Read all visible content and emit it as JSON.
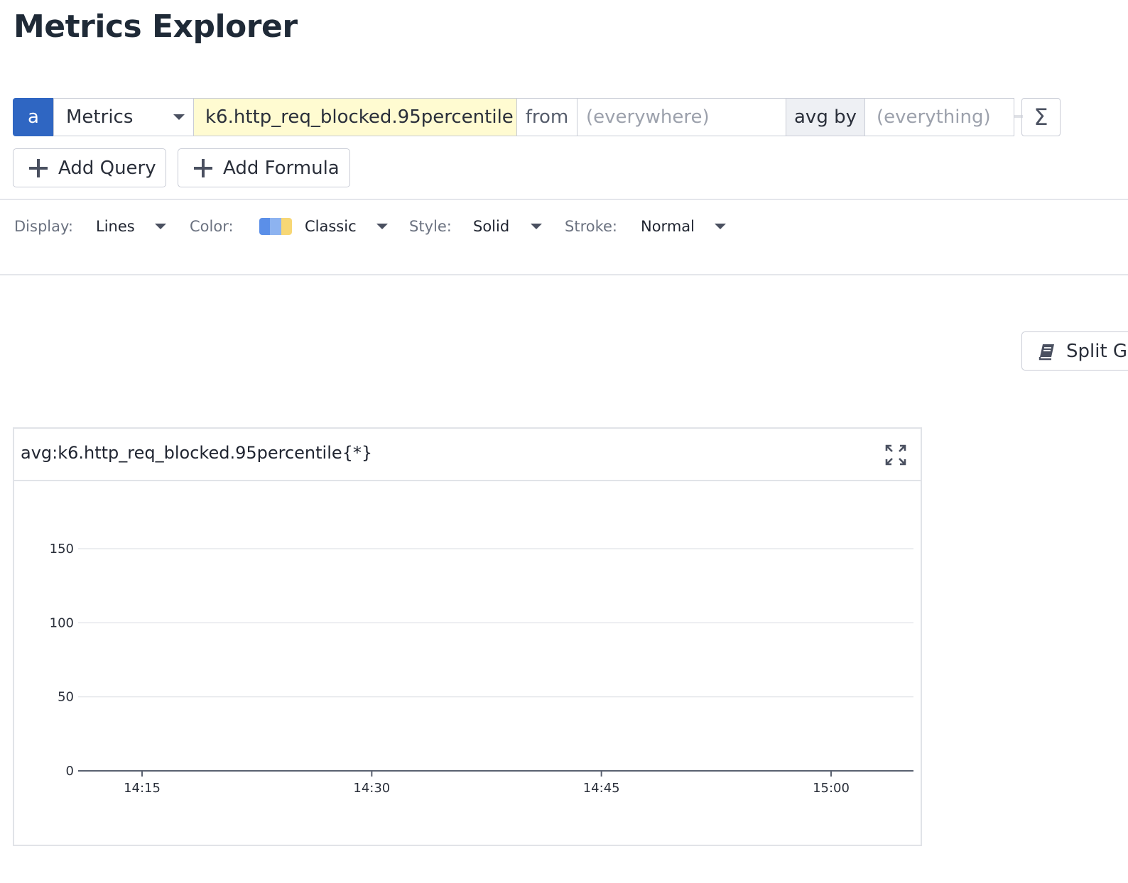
{
  "page": {
    "title": "Metrics Explorer"
  },
  "query": {
    "letter": "a",
    "source": "Metrics",
    "metric": "k6.http_req_blocked.95percentile",
    "from_label": "from",
    "from_placeholder": "(everywhere)",
    "agg_label": "avg by",
    "agg_placeholder": "(everything)",
    "sigma": "Σ"
  },
  "buttons": {
    "add_query": "Add Query",
    "add_formula": "Add Formula",
    "split": "Split G"
  },
  "display_options": {
    "display_label": "Display:",
    "display_value": "Lines",
    "color_label": "Color:",
    "color_value": "Classic",
    "color_swatch": [
      "#5b8fe8",
      "#8db3f0",
      "#f7d775"
    ],
    "style_label": "Style:",
    "style_value": "Solid",
    "stroke_label": "Stroke:",
    "stroke_value": "Normal"
  },
  "panel": {
    "title": "avg:k6.http_req_blocked.95percentile{*}"
  },
  "chart_data": {
    "type": "line",
    "title": "avg:k6.http_req_blocked.95percentile{*}",
    "xlabel": "",
    "ylabel": "",
    "x_ticks": [
      "14:15",
      "14:30",
      "14:45",
      "15:00"
    ],
    "y_ticks": [
      0,
      50,
      100,
      150
    ],
    "ylim": [
      0,
      150
    ],
    "grid": true,
    "series": []
  }
}
